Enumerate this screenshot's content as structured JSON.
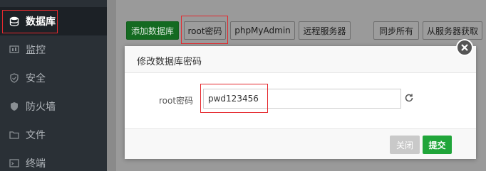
{
  "sidebar": {
    "items": [
      {
        "label": "数据库",
        "icon": "database-icon"
      },
      {
        "label": "监控",
        "icon": "monitor-icon"
      },
      {
        "label": "安全",
        "icon": "shield-icon"
      },
      {
        "label": "防火墙",
        "icon": "firewall-icon"
      },
      {
        "label": "文件",
        "icon": "folder-icon"
      },
      {
        "label": "终端",
        "icon": "terminal-icon"
      }
    ]
  },
  "toolbar": {
    "add_db": "添加数据库",
    "root_pwd": "root密码",
    "phpmyadmin": "phpMyAdmin",
    "remote_server": "远程服务器",
    "sync_all": "同步所有",
    "fetch_from_server": "从服务器获取"
  },
  "background": {
    "partial_text": "空"
  },
  "modal": {
    "title": "修改数据库密码",
    "field_label": "root密码",
    "password_value": "pwd123456",
    "close_label": "关闭",
    "submit_label": "提交"
  },
  "colors": {
    "accent": "#20a53a",
    "highlight": "#e5292e",
    "sidebar_bg": "#2a3036"
  }
}
